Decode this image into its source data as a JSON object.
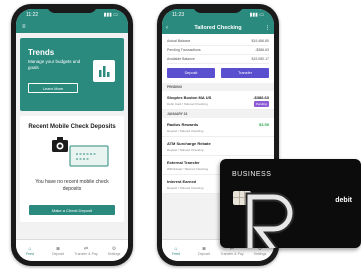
{
  "colors": {
    "teal": "#2b8a7e",
    "purple_button": "#5a4fcf",
    "badge_purple": "#8e5bd6",
    "positive": "#2ea44f",
    "card_black": "#0c0c0c"
  },
  "left_phone": {
    "status_time": "11:22",
    "trends": {
      "title": "Trends",
      "description": "Manage your budgets and goals",
      "button": "Learn More",
      "icon": "bar-chart-icon"
    },
    "deposits": {
      "title": "Recent Mobile Check Deposits",
      "empty_text": "You have no recent mobile check deposits",
      "button": "Make a Check Deposit"
    },
    "tabs": [
      {
        "label": "Feed",
        "icon": "home-icon"
      },
      {
        "label": "Deposit",
        "icon": "camera-icon"
      },
      {
        "label": "Transfer & Pay",
        "icon": "transfer-icon"
      },
      {
        "label": "Settings",
        "icon": "gear-icon"
      }
    ]
  },
  "right_phone": {
    "status_time": "11:23",
    "title": "Tailored Checking",
    "balances": [
      {
        "label": "Actual Balance",
        "value": "$19,466.80"
      },
      {
        "label": "Pending Transactions",
        "value": "-$386.63"
      },
      {
        "label": "Available Balance",
        "value": "$19,080.17"
      }
    ],
    "actions": {
      "deposit": "Deposit",
      "transfer": "Transfer"
    },
    "sections": {
      "pending": "PENDING",
      "date": "JANUARY 24"
    },
    "transactions": [
      {
        "name": "Shoplex Boston MA US",
        "sub": "Debit Card / Tailored Checking",
        "amount": "-$386.63",
        "badge": "Pending"
      },
      {
        "name": "Radius Rewards",
        "sub": "Deposit / Tailored Checking",
        "amount": "$3.59"
      },
      {
        "name": "ATM Surcharge Rebate",
        "sub": "Deposit / Tailored Checking",
        "amount": ""
      },
      {
        "name": "External Transfer",
        "sub": "Withdrawal / Tailored Checking",
        "amount": ""
      },
      {
        "name": "Interest Earned",
        "sub": "Deposit / Tailored Checking",
        "amount": ""
      }
    ],
    "tabs": [
      {
        "label": "Feed",
        "icon": "home-icon"
      },
      {
        "label": "Deposit",
        "icon": "camera-icon"
      },
      {
        "label": "Transfer & Pay",
        "icon": "transfer-icon"
      },
      {
        "label": "Settings",
        "icon": "gear-icon"
      }
    ]
  },
  "debit_card": {
    "brand": "BUSINESS",
    "type": "debit",
    "logo": "radius-r-logo-icon"
  }
}
